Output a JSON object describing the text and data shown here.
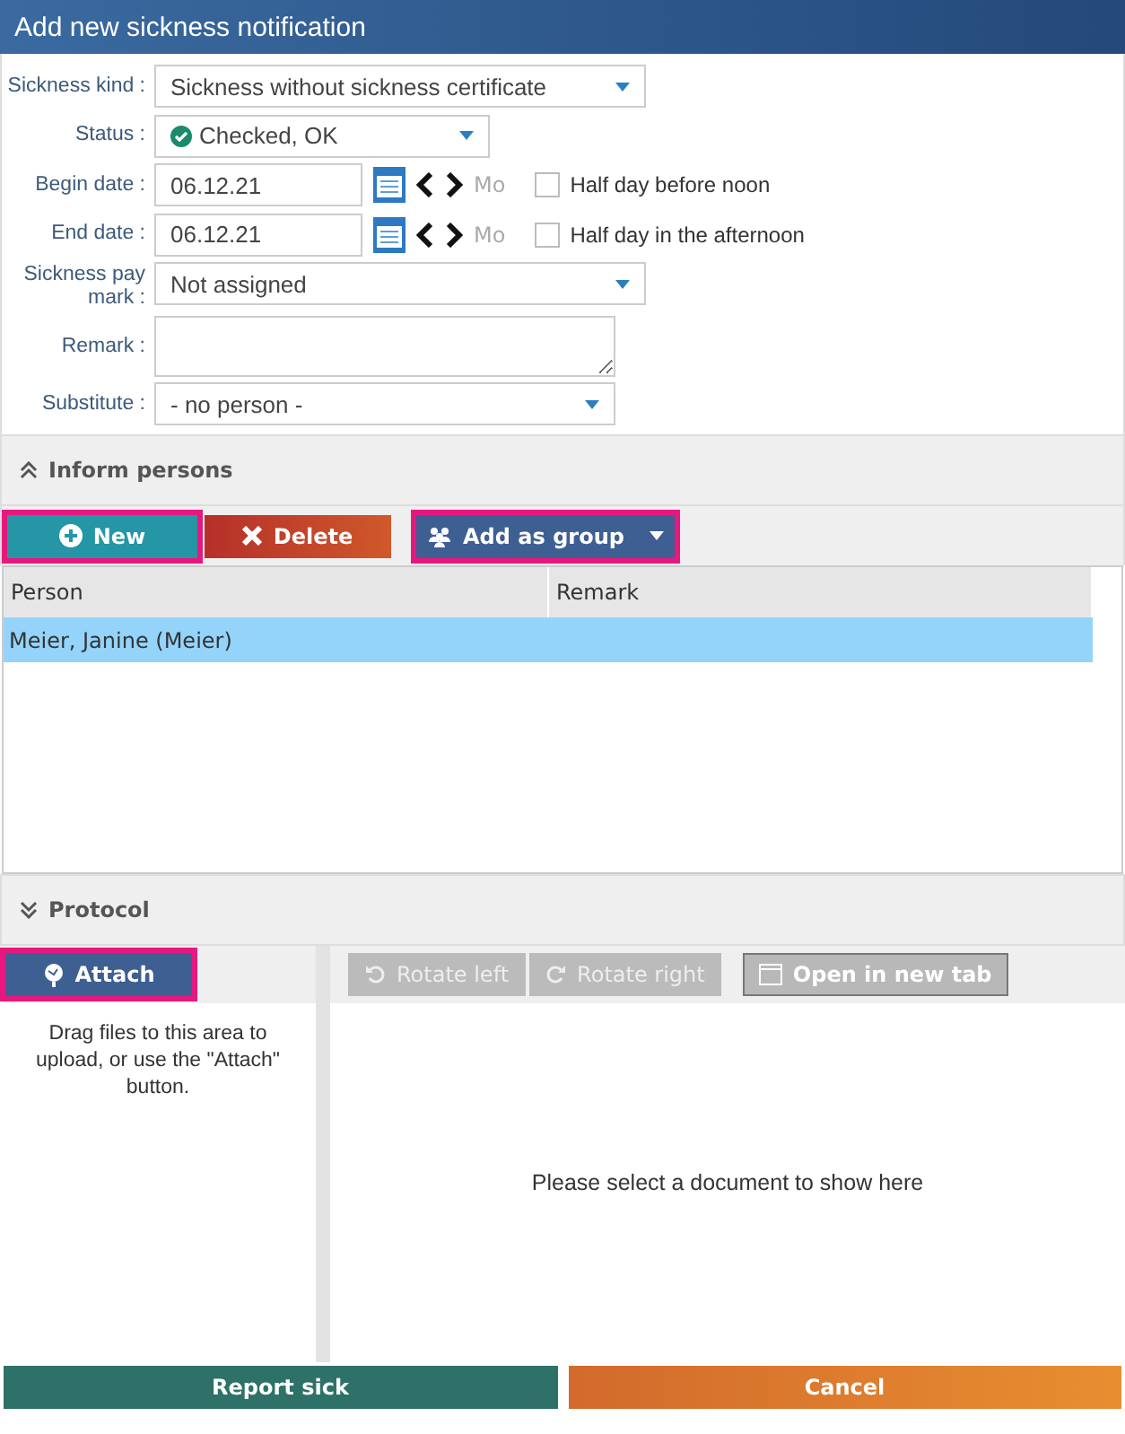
{
  "window": {
    "title": "Add new sickness notification"
  },
  "form": {
    "sickness_kind": {
      "label": "Sickness kind :",
      "value": "Sickness without sickness certificate"
    },
    "status": {
      "label": "Status :",
      "value": "Checked, OK"
    },
    "begin_date": {
      "label": "Begin date :",
      "value": "06.12.21",
      "weekday": "Mo",
      "checkbox_label": "Half day before noon",
      "checked": false
    },
    "end_date": {
      "label": "End date :",
      "value": "06.12.21",
      "weekday": "Mo",
      "checkbox_label": "Half day in the afternoon",
      "checked": false
    },
    "sickness_pay_mark": {
      "label": "Sickness pay mark :",
      "value": "Not assigned"
    },
    "remark": {
      "label": "Remark :"
    },
    "substitute": {
      "label": "Substitute :",
      "value": "- no person -"
    }
  },
  "inform_persons": {
    "title": "Inform persons",
    "expanded": true,
    "buttons": [
      {
        "kind": "new",
        "label": "New",
        "highlighted": true
      },
      {
        "kind": "delete",
        "label": "Delete",
        "highlighted": false
      },
      {
        "kind": "group",
        "label": "Add as group",
        "highlighted": true
      }
    ],
    "table": {
      "columns": [
        "Person",
        "Remark"
      ],
      "rows": [
        {
          "person": "Meier, Janine (Meier)",
          "selected": true
        }
      ]
    }
  },
  "protocol": {
    "title": "Protocol",
    "expanded": false,
    "attach": {
      "label": "Attach",
      "highlighted": true
    },
    "hint": "Drag files to this area to upload, or use the \"Attach\" button.",
    "tools": [
      {
        "kind": "rotate_left",
        "label": "Rotate left",
        "disabled": true
      },
      {
        "kind": "rotate_right",
        "label": "Rotate right",
        "disabled": true
      },
      {
        "kind": "open_tab",
        "label": "Open in new tab",
        "disabled": false
      }
    ],
    "empty_message": "Please select a document to show here"
  },
  "footer": [
    {
      "kind": "primary",
      "label": "Report sick"
    },
    {
      "kind": "cancel",
      "label": "Cancel"
    }
  ]
}
